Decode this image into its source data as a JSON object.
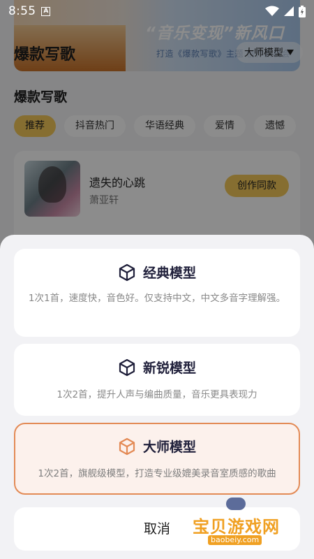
{
  "status_bar": {
    "time": "8:55",
    "notification_icon": "A"
  },
  "background_page": {
    "banner": {
      "line1": "“音乐变现”新风口",
      "line2": "打造《爆款写歌》主题 创作新机会"
    },
    "header_title": "爆款写歌",
    "model_select_label": "大师模型",
    "section_title": "爆款写歌",
    "tabs": [
      {
        "label": "推荐",
        "active": true
      },
      {
        "label": "抖音热门",
        "active": false
      },
      {
        "label": "华语经典",
        "active": false
      },
      {
        "label": "爱情",
        "active": false
      },
      {
        "label": "遗憾",
        "active": false
      }
    ],
    "song": {
      "title": "遗失的心跳",
      "artist": "萧亚轩",
      "create_label": "创作同款"
    }
  },
  "sheet": {
    "options": [
      {
        "title": "经典模型",
        "description": "1次1首，速度快，音色好。仅支持中文，中文多音字理解强。",
        "selected": false,
        "icon": "cube-icon"
      },
      {
        "title": "新锐模型",
        "description": "1次2首，提升人声与编曲质量，音乐更具表现力",
        "selected": false,
        "icon": "cube-icon"
      },
      {
        "title": "大师模型",
        "description": "1次2首，旗舰级模型，打造专业级媲美录音室质感的歌曲",
        "selected": true,
        "icon": "cube-icon"
      }
    ],
    "cancel_label": "取消"
  },
  "watermark": {
    "text": "宝贝游戏网",
    "url": "baobeiy.com"
  },
  "colors": {
    "accent_yellow": "#f5c95a",
    "selected_border": "#e38a55",
    "selected_bg": "#fcf1ec",
    "selected_icon": "#e38a55",
    "icon_dark": "#1f1f3a"
  }
}
